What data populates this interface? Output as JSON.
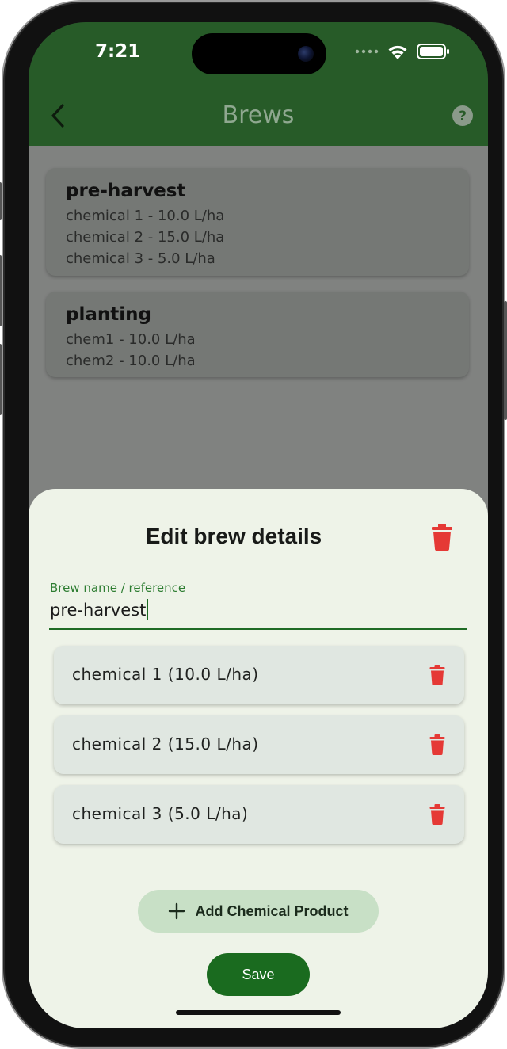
{
  "status_bar": {
    "time": "7:21"
  },
  "app_bar": {
    "title": "Brews"
  },
  "brews": [
    {
      "name": "pre-harvest",
      "items": [
        "chemical 1 - 10.0 L/ha",
        "chemical 2 - 15.0 L/ha",
        "chemical 3 - 5.0 L/ha"
      ]
    },
    {
      "name": "planting",
      "items": [
        "chem1 - 10.0 L/ha",
        "chem2 - 10.0 L/ha"
      ]
    }
  ],
  "sheet": {
    "title": "Edit brew details",
    "field_label": "Brew name / reference",
    "field_value": "pre-harvest",
    "chemicals": [
      "chemical 1 (10.0 L/ha)",
      "chemical 2 (15.0 L/ha)",
      "chemical 3 (5.0 L/ha)"
    ],
    "add_label": "Add Chemical Product",
    "save_label": "Save"
  },
  "icons": {
    "back": "chevron-left-icon",
    "help": "help-circle-icon",
    "delete": "trash-icon",
    "add": "plus-icon"
  },
  "colors": {
    "app_bar": "#275b28",
    "sheet_bg": "#eef3e8",
    "accent_green": "#1a6b1f",
    "delete_red": "#e53935",
    "add_button_bg": "#c8e0c6"
  }
}
